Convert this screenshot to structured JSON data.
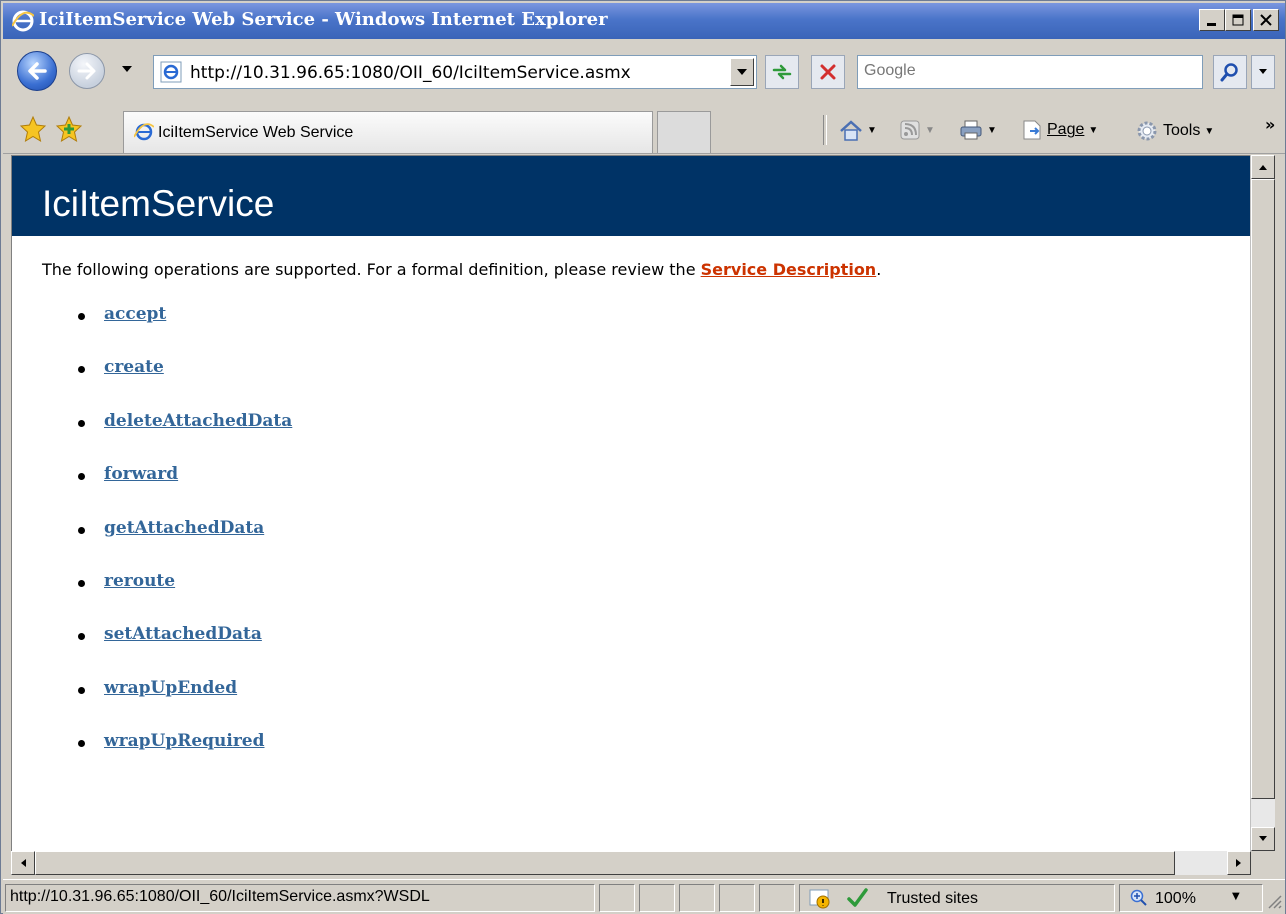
{
  "window": {
    "title": "IciItemService Web Service - Windows Internet Explorer"
  },
  "navigation": {
    "address_url": "http://10.31.96.65:1080/OII_60/IciItemService.asmx",
    "search_placeholder": "Google"
  },
  "tabs": [
    {
      "label": "IciItemService Web Service"
    }
  ],
  "command_bar": {
    "page_label": "Page",
    "tools_label": "Tools"
  },
  "page": {
    "heading": "IciItemService",
    "intro_text": "The following operations are supported. For a formal definition, please review the ",
    "service_description_link": "Service Description",
    "intro_suffix": ".",
    "operations": [
      "accept",
      "create",
      "deleteAttachedData",
      "forward",
      "getAttachedData",
      "reroute",
      "setAttachedData",
      "wrapUpEnded",
      "wrapUpRequired"
    ]
  },
  "status_bar": {
    "url": "http://10.31.96.65:1080/OII_60/IciItemService.asmx?WSDL",
    "zone": "Trusted sites",
    "zoom": "100%"
  },
  "colors": {
    "heading_bg": "#003366",
    "link": "#336699",
    "service_link": "#cc3300"
  },
  "icons": [
    "ie-logo-icon",
    "back-arrow-icon",
    "forward-arrow-icon",
    "refresh-icon",
    "stop-icon",
    "search-icon",
    "favorites-star-icon",
    "add-favorites-icon",
    "home-icon",
    "feeds-icon",
    "print-icon",
    "page-icon",
    "tools-gear-icon",
    "protected-mode-icon",
    "checkmark-icon",
    "zoom-icon"
  ]
}
